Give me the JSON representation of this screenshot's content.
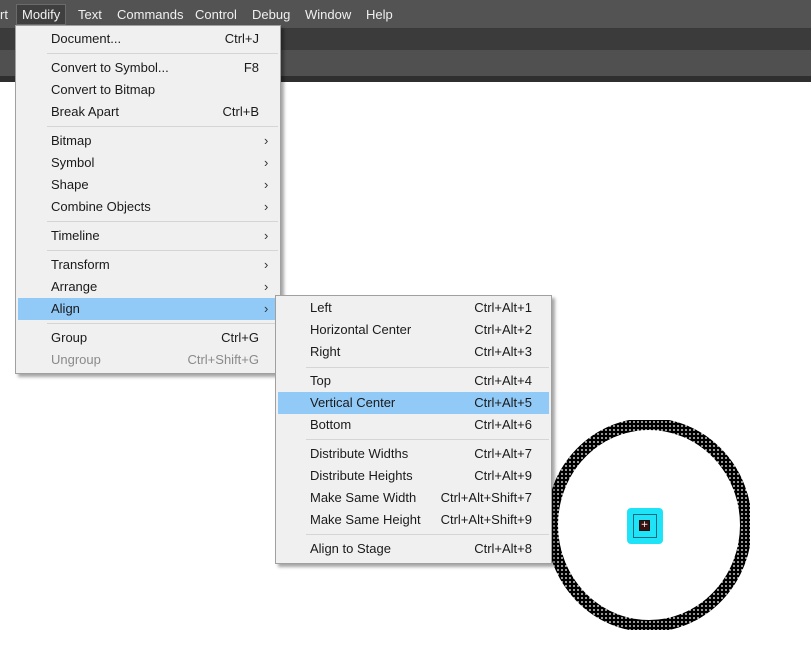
{
  "menubar": {
    "items": [
      "rt",
      "Modify",
      "Text",
      "Commands",
      "Control",
      "Debug",
      "Window",
      "Help"
    ],
    "active_index": 1
  },
  "modify_menu": {
    "items": [
      {
        "label": "Document...",
        "shortcut": "Ctrl+J"
      },
      {
        "label": "Convert to Symbol...",
        "shortcut": "F8"
      },
      {
        "label": "Convert to Bitmap",
        "shortcut": ""
      },
      {
        "label": "Break Apart",
        "shortcut": "Ctrl+B"
      },
      {
        "label": "Bitmap",
        "shortcut": "",
        "submenu": true
      },
      {
        "label": "Symbol",
        "shortcut": "",
        "submenu": true
      },
      {
        "label": "Shape",
        "shortcut": "",
        "submenu": true
      },
      {
        "label": "Combine Objects",
        "shortcut": "",
        "submenu": true
      },
      {
        "label": "Timeline",
        "shortcut": "",
        "submenu": true
      },
      {
        "label": "Transform",
        "shortcut": "",
        "submenu": true
      },
      {
        "label": "Arrange",
        "shortcut": "",
        "submenu": true
      },
      {
        "label": "Align",
        "shortcut": "",
        "submenu": true,
        "highlighted": true
      },
      {
        "label": "Group",
        "shortcut": "Ctrl+G"
      },
      {
        "label": "Ungroup",
        "shortcut": "Ctrl+Shift+G",
        "disabled": true
      }
    ],
    "arrow_glyph": "›"
  },
  "align_menu": {
    "items": [
      {
        "label": "Left",
        "shortcut": "Ctrl+Alt+1"
      },
      {
        "label": "Horizontal Center",
        "shortcut": "Ctrl+Alt+2"
      },
      {
        "label": "Right",
        "shortcut": "Ctrl+Alt+3"
      },
      {
        "label": "Top",
        "shortcut": "Ctrl+Alt+4"
      },
      {
        "label": "Vertical Center",
        "shortcut": "Ctrl+Alt+5",
        "highlighted": true
      },
      {
        "label": "Bottom",
        "shortcut": "Ctrl+Alt+6"
      },
      {
        "label": "Distribute Widths",
        "shortcut": "Ctrl+Alt+7"
      },
      {
        "label": "Distribute Heights",
        "shortcut": "Ctrl+Alt+9"
      },
      {
        "label": "Make Same Width",
        "shortcut": "Ctrl+Alt+Shift+7"
      },
      {
        "label": "Make Same Height",
        "shortcut": "Ctrl+Alt+Shift+9"
      },
      {
        "label": "Align to Stage",
        "shortcut": "Ctrl+Alt+8"
      }
    ]
  },
  "stage": {
    "registration_glyph": "+"
  },
  "colors": {
    "menubar_bg": "#535353",
    "menu_bg": "#f0f0f0",
    "highlight": "#91c9f7",
    "selection": "#1fe3f7"
  }
}
